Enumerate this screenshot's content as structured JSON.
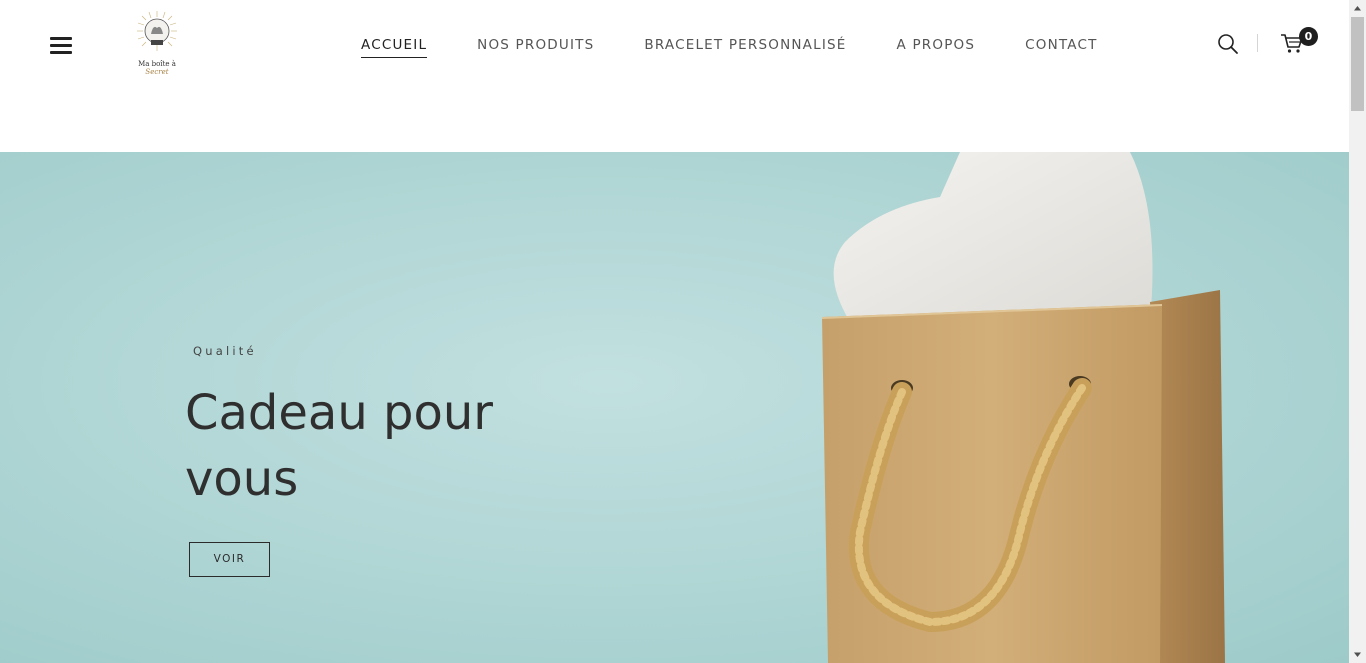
{
  "header": {
    "logo": {
      "line1": "Ma boîte à",
      "line2": "Secret"
    },
    "nav": [
      {
        "label": "ACCUEIL",
        "active": true
      },
      {
        "label": "NOS PRODUITS",
        "active": false
      },
      {
        "label": "BRACELET PERSONNALISÉ",
        "active": false
      },
      {
        "label": "A PROPOS",
        "active": false
      },
      {
        "label": "CONTACT",
        "active": false
      }
    ],
    "icons": {
      "menu": "hamburger-menu-icon",
      "search": "search-icon",
      "cart": "cart-icon"
    },
    "cart_count": "0"
  },
  "hero": {
    "subtitle": "Qualité",
    "title": "Cadeau pour vous",
    "button_label": "VOIR",
    "background_color": "#b2d7d6"
  },
  "colors": {
    "text": "#2b2b2b",
    "nav_text": "#555555",
    "badge": "#1e1e1e",
    "kraft_bag": "#c9a26a"
  }
}
